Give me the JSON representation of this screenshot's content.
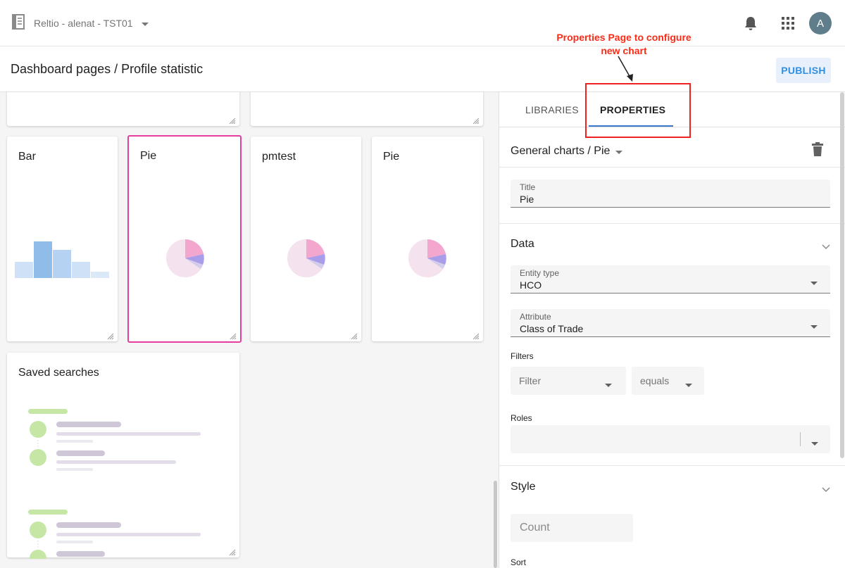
{
  "app": {
    "tenant": "Reltio - alenat - TST01",
    "avatar_initial": "A"
  },
  "header": {
    "title": "Dashboard pages / Profile statistic",
    "publish_label": "PUBLISH"
  },
  "annotation": {
    "line1": "Properties Page to configure",
    "line2": "new chart"
  },
  "canvas": {
    "cards": [
      {
        "title": "Bar",
        "graphic": "bar-chart"
      },
      {
        "title": "Pie",
        "graphic": "pie-chart",
        "selected": true
      },
      {
        "title": "pmtest",
        "graphic": "pie-chart"
      },
      {
        "title": "Pie",
        "graphic": "pie-chart"
      },
      {
        "title": "Saved searches",
        "graphic": "saved-searches-list"
      }
    ]
  },
  "panel": {
    "tabs": [
      {
        "label": "LIBRARIES",
        "active": false
      },
      {
        "label": "PROPERTIES",
        "active": true
      }
    ],
    "chart_type": "General charts / Pie",
    "title_field": {
      "label": "Title",
      "value": "Pie"
    },
    "data_section": {
      "title": "Data",
      "entity_type": {
        "label": "Entity type",
        "value": "HCO"
      },
      "attribute": {
        "label": "Attribute",
        "value": "Class of Trade"
      },
      "filters_label": "Filters",
      "filter_placeholder": "Filter",
      "operator": "equals",
      "roles_label": "Roles"
    },
    "style_section": {
      "title": "Style",
      "count_placeholder": "Count",
      "sort_label": "Sort"
    }
  },
  "colors": {
    "accent": "#2f8fe0",
    "selected_border": "#e63ea0",
    "annotation": "#ff2a16",
    "tab_ink": "#3b78c8"
  }
}
